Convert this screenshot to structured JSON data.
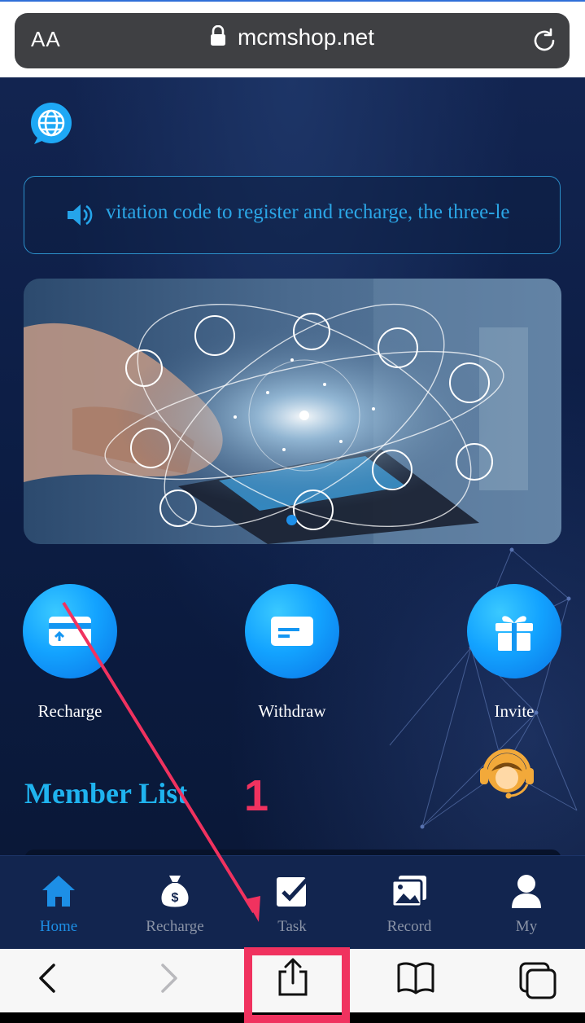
{
  "browser": {
    "text_size_label": "AA",
    "url": "mcmshop.net"
  },
  "notice": {
    "text": "vitation code to register and recharge, the three-le"
  },
  "actions": [
    {
      "label": "Recharge"
    },
    {
      "label": "Withdraw"
    },
    {
      "label": "Invite"
    }
  ],
  "member_list": {
    "title": "Member List"
  },
  "tabbar": {
    "items": [
      {
        "label": "Home",
        "active": true
      },
      {
        "label": "Recharge",
        "active": false
      },
      {
        "label": "Task",
        "active": false
      },
      {
        "label": "Record",
        "active": false
      },
      {
        "label": "My",
        "active": false
      }
    ]
  },
  "annotation": {
    "step_number": "1"
  },
  "colors": {
    "accent_blue": "#1d8fe6",
    "title_cyan": "#1fb3ef",
    "annotation_red": "#f0325f",
    "page_bg": "#0b1a3a"
  }
}
